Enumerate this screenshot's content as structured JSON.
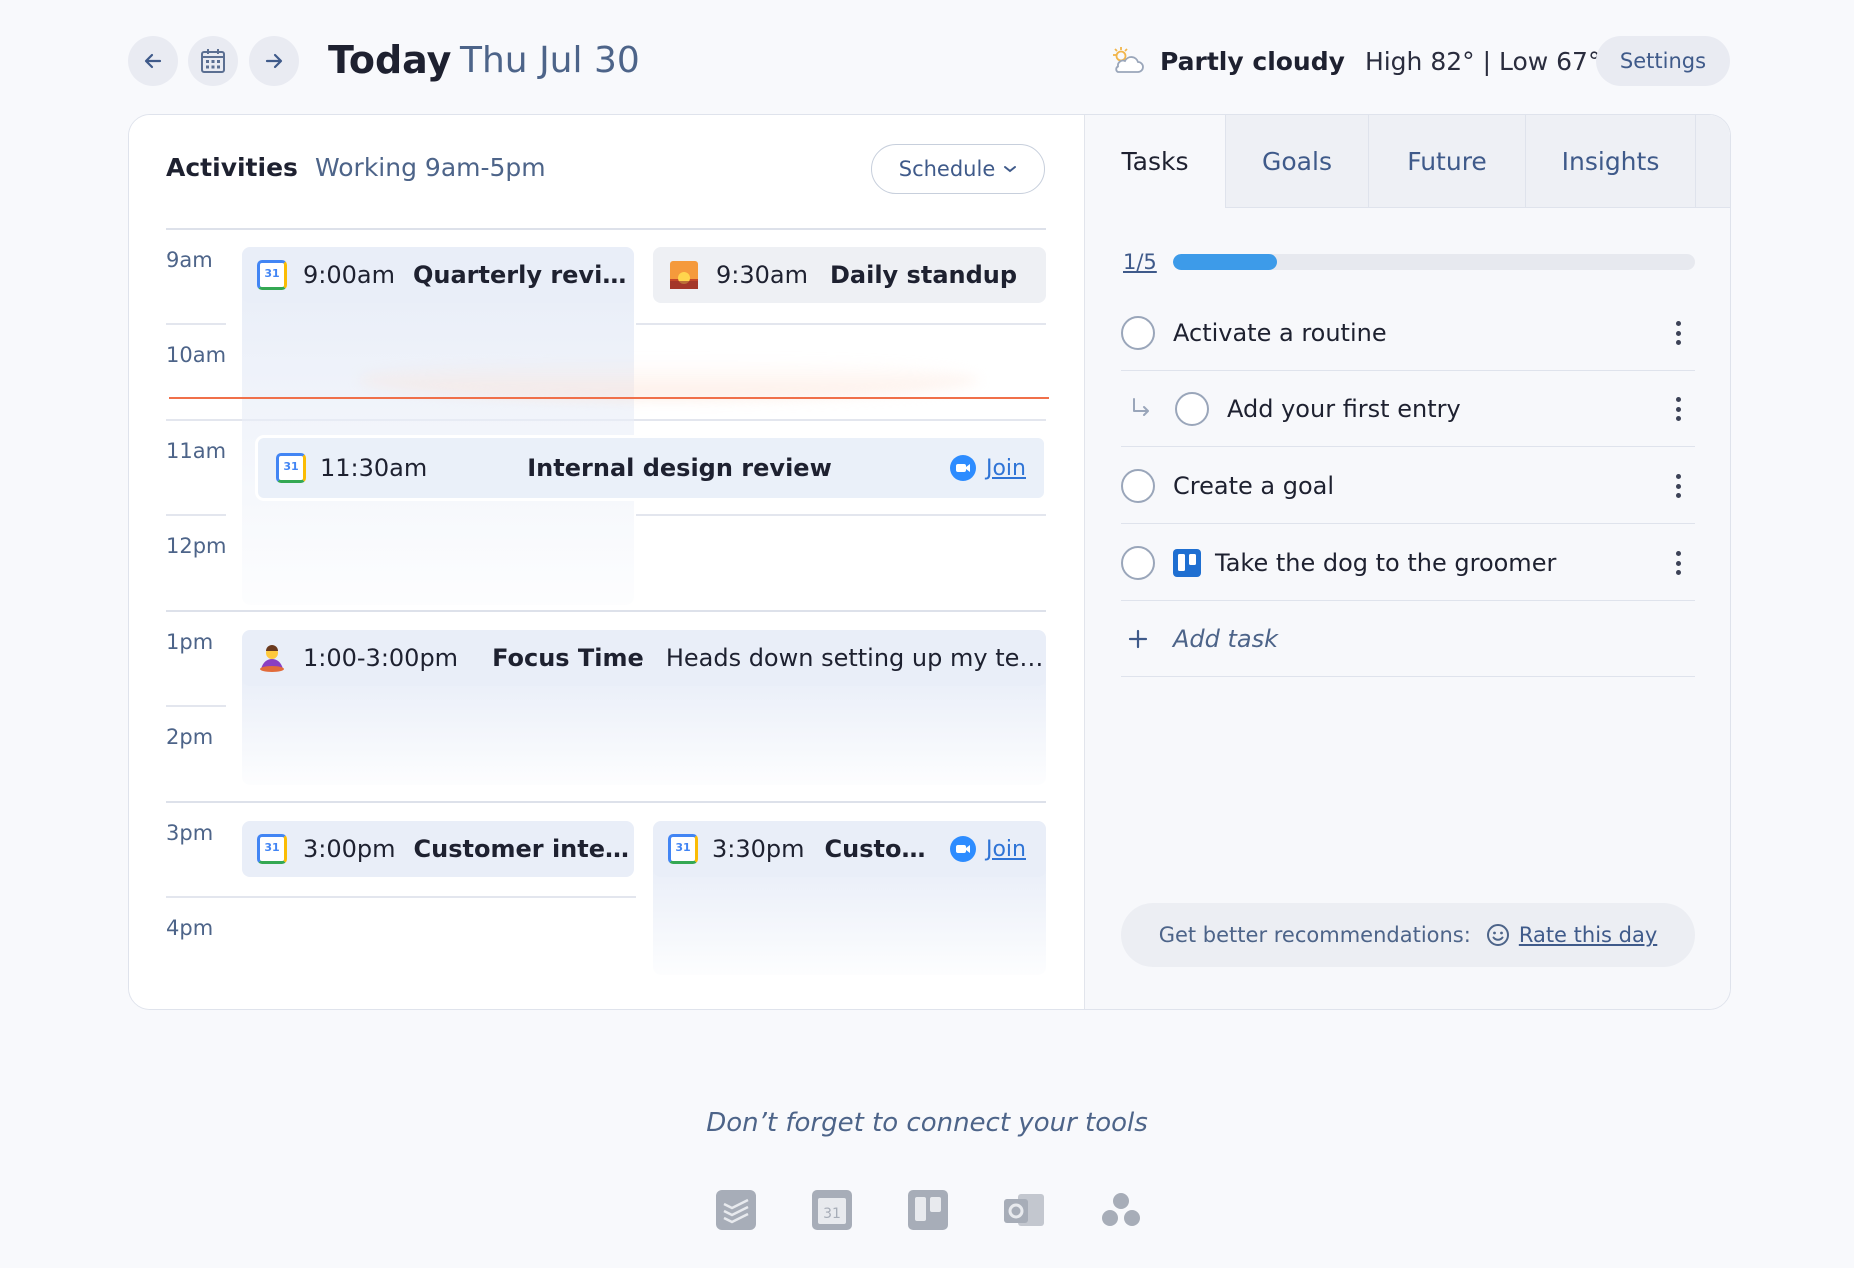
{
  "header": {
    "title": "Today",
    "date": "Thu Jul 30",
    "weather_condition": "Partly cloudy",
    "weather_temps": "High 82° | Low 67°",
    "settings_label": "Settings"
  },
  "activities": {
    "title": "Activities",
    "working_hours": "Working 9am-5pm",
    "schedule_label": "Schedule",
    "hours": [
      "9am",
      "10am",
      "11am",
      "12pm",
      "1pm",
      "2pm",
      "3pm",
      "4pm"
    ],
    "events": [
      {
        "time": "9:00am",
        "title": "Quarterly revie...",
        "icon": "google-calendar-icon"
      },
      {
        "time": "9:30am",
        "title": "Daily standup",
        "icon": "sunrise-icon"
      },
      {
        "time": "11:30am",
        "title": "Internal design review",
        "icon": "google-calendar-icon",
        "join": "Join"
      },
      {
        "time": "1:00-3:00pm",
        "title": "Focus Time",
        "description": "Heads down setting up my tea...",
        "icon": "meditation-icon"
      },
      {
        "time": "3:00pm",
        "title": "Customer inter...",
        "icon": "google-calendar-icon"
      },
      {
        "time": "3:30pm",
        "title": "Custom...",
        "icon": "google-calendar-icon",
        "join": "Join"
      }
    ]
  },
  "panel": {
    "tabs": [
      "Tasks",
      "Goals",
      "Future",
      "Insights"
    ],
    "active_tab": "Tasks",
    "progress_label": "1/5",
    "progress_fraction": 0.2,
    "tasks": [
      {
        "label": "Activate a routine"
      },
      {
        "label": "Add your first entry",
        "subtask": true
      },
      {
        "label": "Create a goal"
      },
      {
        "label": "Take the dog to the groomer",
        "icon": "trello-icon"
      }
    ],
    "add_task_label": "Add task",
    "recommend_text": "Get better recommendations:",
    "rate_link": "Rate this day"
  },
  "footer": {
    "connect_text": "Don’t forget to connect your tools",
    "tools": [
      "todoist-icon",
      "google-calendar-icon",
      "trello-icon",
      "outlook-icon",
      "asana-icon"
    ]
  },
  "colors": {
    "accent": "#3d9be9",
    "now_line": "#f0704a",
    "link": "#2f74d6",
    "muted_text": "#4d6489"
  }
}
